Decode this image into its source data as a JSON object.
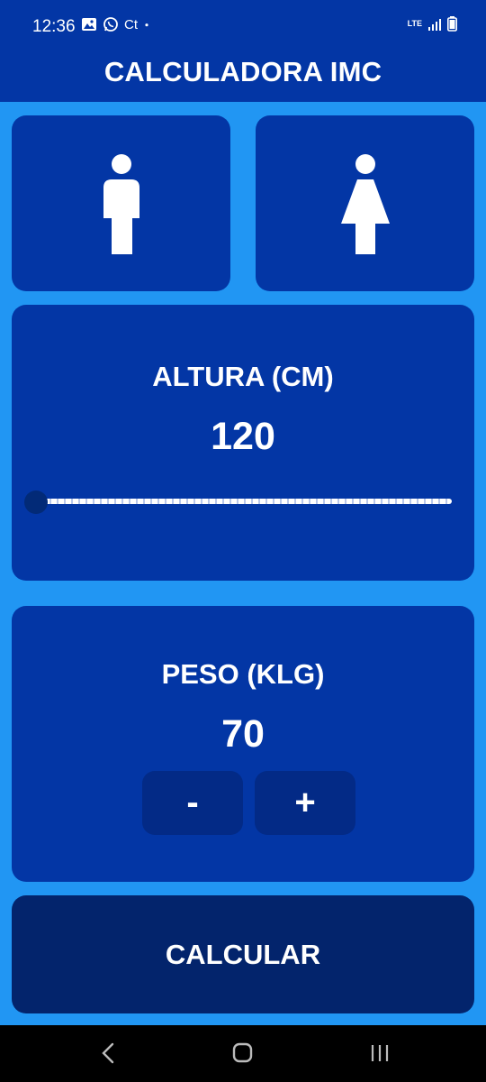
{
  "status_bar": {
    "time": "12:36",
    "network": "LTE",
    "app_icons": [
      "gallery-icon",
      "whatsapp-icon",
      "ct-icon",
      "dot-icon"
    ],
    "ct_text": "Ct"
  },
  "app_bar": {
    "title": "CALCULADORA IMC"
  },
  "gender": {
    "options": [
      "male-icon",
      "female-icon"
    ]
  },
  "height": {
    "label": "ALTURA (CM)",
    "value": "120",
    "slider_fraction": 0.0
  },
  "weight": {
    "label": "PESO (KLG)",
    "value": "70",
    "minus_label": "-",
    "plus_label": "+"
  },
  "calculate": {
    "label": "CALCULAR"
  },
  "colors": {
    "background": "#2196f3",
    "card": "#0336a5",
    "button_dark": "#03246c",
    "stepper": "#032a86"
  }
}
